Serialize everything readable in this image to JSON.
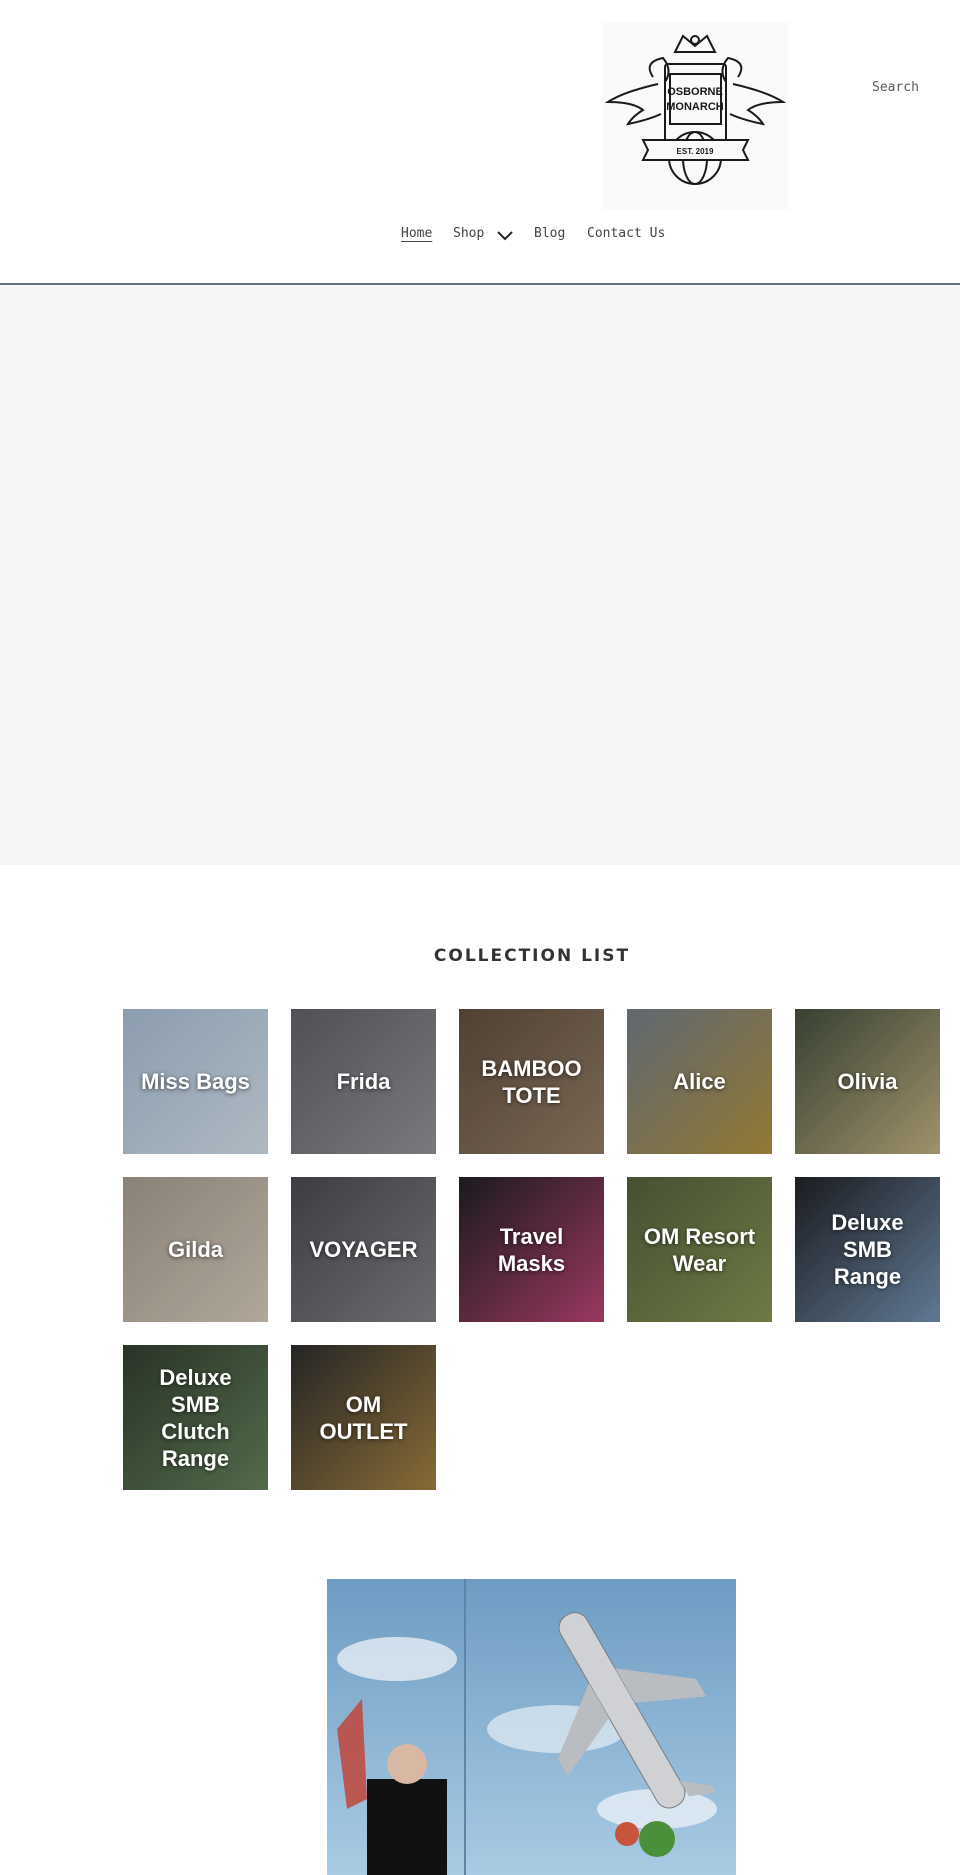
{
  "header": {
    "logo": {
      "line1": "OSBORNE",
      "line2": "MONARCH",
      "est": "EST. 2019"
    },
    "search_label": "Search"
  },
  "nav": {
    "items": [
      {
        "label": "Home",
        "active": true
      },
      {
        "label": "Shop",
        "has_dropdown": true
      },
      {
        "label": "Blog"
      },
      {
        "label": "Contact Us"
      }
    ]
  },
  "collections": {
    "title": "COLLECTION LIST",
    "items": [
      {
        "label": "Miss Bags",
        "colors": [
          "#9fb3c8",
          "#c7d3dd"
        ]
      },
      {
        "label": "Frida",
        "colors": [
          "#5a5c62",
          "#8a8b90"
        ]
      },
      {
        "label": "BAMBOO TOTE",
        "colors": [
          "#5b4a3a",
          "#8b7660"
        ]
      },
      {
        "label": "Alice",
        "colors": [
          "#6d7782",
          "#a7893a"
        ]
      },
      {
        "label": "Olivia",
        "colors": [
          "#3f4a3a",
          "#b6a67a"
        ]
      },
      {
        "label": "Gilda",
        "colors": [
          "#9c9488",
          "#c9bfb0"
        ]
      },
      {
        "label": "VOYAGER",
        "colors": [
          "#45464c",
          "#7b7a80"
        ]
      },
      {
        "label": "Travel Masks",
        "colors": [
          "#1e1e22",
          "#b0406e"
        ]
      },
      {
        "label": "OM Resort Wear",
        "colors": [
          "#4f5b3a",
          "#7e8c4e"
        ]
      },
      {
        "label": "Deluxe SMB Range",
        "colors": [
          "#1f2024",
          "#6e8aa8"
        ]
      },
      {
        "label": "Deluxe SMB Clutch Range",
        "colors": [
          "#2f3b2c",
          "#5e7a56"
        ]
      },
      {
        "label": "OM OUTLET",
        "colors": [
          "#2a2a2a",
          "#9b7a3e"
        ]
      }
    ]
  },
  "feature": {
    "colors": {
      "sky": "#8db7d8",
      "sky_light": "#cfe2ee",
      "plane": "#c9c9c9"
    }
  }
}
